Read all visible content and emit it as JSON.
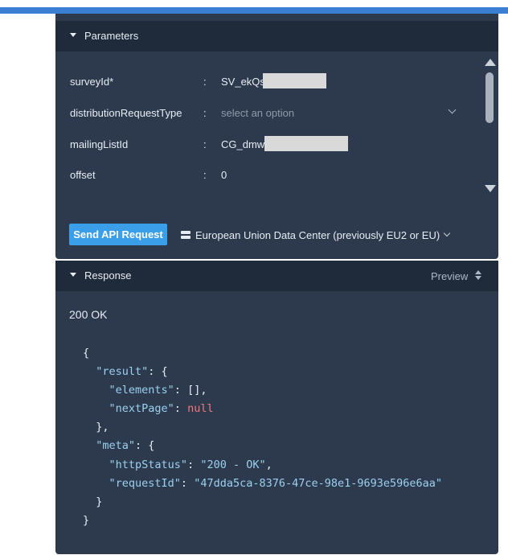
{
  "parameters": {
    "header_title": "Parameters",
    "rows": [
      {
        "label": "surveyId*",
        "separator": ":",
        "value": "SV_ekQs"
      },
      {
        "label": "distributionRequestType",
        "separator": ":",
        "placeholder": "select an option"
      },
      {
        "label": "mailingListId",
        "separator": ":",
        "value": "CG_dmw"
      },
      {
        "label": "offset",
        "separator": ":",
        "value": "0"
      }
    ]
  },
  "actions": {
    "send_label": "Send API Request",
    "data_center_label": "European Union Data Center (previously EU2 or EU)"
  },
  "response": {
    "header_title": "Response",
    "view_mode": "Preview",
    "status_line": "200 OK",
    "json": {
      "open_brace": "{",
      "result_key": "\"result\"",
      "elements_key": "\"elements\"",
      "elements_value": "[]",
      "nextPage_key": "\"nextPage\"",
      "nextPage_value": "null",
      "meta_key": "\"meta\"",
      "httpStatus_key": "\"httpStatus\"",
      "httpStatus_value": "\"200 - OK\"",
      "requestId_key": "\"requestId\"",
      "requestId_value": "\"47dda5ca-8376-47ce-98e1-9693e596e6aa\"",
      "close_brace": "}"
    }
  },
  "icons": {
    "collapse_params": "caret-down-icon",
    "collapse_response": "caret-down-icon",
    "select_chevron": "chevron-down-icon",
    "data_center": "server-icon",
    "data_center_chevron": "chevron-down-icon",
    "sort": "sort-icon",
    "scroll_up": "arrow-up-icon",
    "scroll_down": "arrow-down-icon"
  },
  "colors": {
    "accent_bar": "#3b7fd4",
    "panel_bg": "#2d3a4e",
    "header_bg": "#1f2a3b",
    "send_button": "#3a9fe8",
    "json_string": "#9bd0ef",
    "json_null": "#f0767c"
  }
}
